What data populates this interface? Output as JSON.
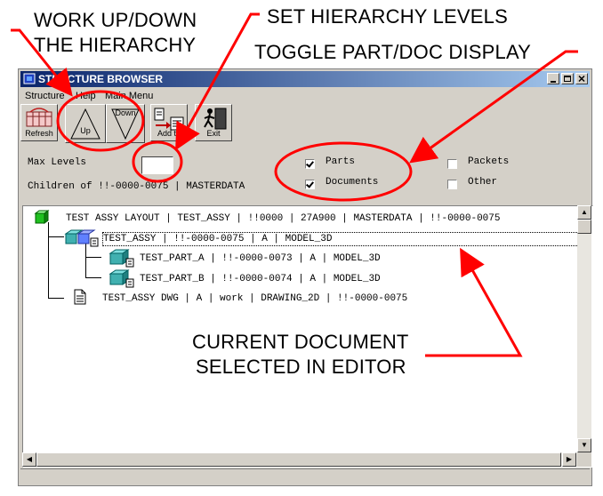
{
  "annotations": {
    "work_up_down_line1": "WORK UP/DOWN",
    "work_up_down_line2": "THE HIERARCHY",
    "set_levels": "SET HIERARCHY LEVELS",
    "toggle_display": "TOGGLE PART/DOC DISPLAY",
    "current_doc_line1": "CURRENT DOCUMENT",
    "current_doc_line2": "SELECTED IN EDITOR",
    "arrow_color": "#ff0000"
  },
  "window": {
    "title": "STRUCTURE BROWSER",
    "title_gradient": [
      "#0a246a",
      "#a6caf0"
    ]
  },
  "menu": {
    "items": [
      "Structure",
      "Help",
      "Main Menu"
    ]
  },
  "toolbar": {
    "refresh_label": "Refresh",
    "up_label": "Up",
    "down_label": "Down",
    "add_to_label": "Add to",
    "exit_label": "Exit"
  },
  "controls": {
    "max_levels_label": "Max Levels",
    "max_levels_value": "",
    "children_of_label": "Children of !!-0000-0075 | MASTERDATA",
    "parts": {
      "label": "Parts",
      "checked": true
    },
    "documents": {
      "label": "Documents",
      "checked": true
    },
    "packets": {
      "label": "Packets",
      "checked": false
    },
    "other": {
      "label": "Other",
      "checked": false
    }
  },
  "tree": {
    "rows": [
      {
        "text": "TEST ASSY LAYOUT | TEST_ASSY | !!0000 | 27A900 | MASTERDATA | !!-0000-0075",
        "icon": "assembly-layout-icon",
        "selected": false
      },
      {
        "text": "TEST_ASSY | !!-0000-0075 | A | MODEL_3D",
        "icon": "assembly-model-icon",
        "selected": true
      },
      {
        "text": "TEST_PART_A | !!-0000-0073 | A | MODEL_3D",
        "icon": "part-model-icon",
        "selected": false
      },
      {
        "text": "TEST_PART_B | !!-0000-0074 | A | MODEL_3D",
        "icon": "part-model-icon",
        "selected": false
      },
      {
        "text": "TEST_ASSY DWG | A | work | DRAWING_2D | !!-0000-0075",
        "icon": "drawing-document-icon",
        "selected": false
      }
    ]
  }
}
